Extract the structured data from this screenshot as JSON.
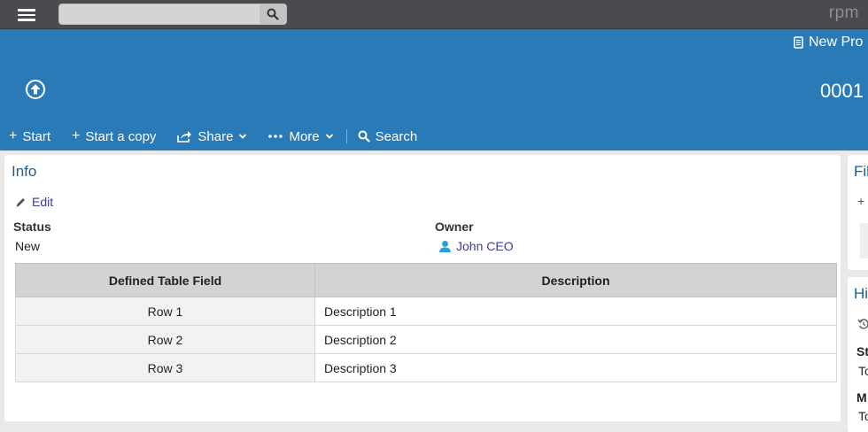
{
  "topbar": {
    "search_placeholder": "",
    "brand": "rpm"
  },
  "header": {
    "process_name": "New Pro",
    "record_number": "0001",
    "actions": {
      "start": "Start",
      "start_copy": "Start a copy",
      "share": "Share",
      "more": "More",
      "search": "Search"
    }
  },
  "info": {
    "title": "Info",
    "edit_label": "Edit",
    "status_label": "Status",
    "status_value": "New",
    "owner_label": "Owner",
    "owner_value": "John CEO",
    "table": {
      "headers": [
        "Defined Table Field",
        "Description"
      ],
      "rows": [
        [
          "Row 1",
          "Description 1"
        ],
        [
          "Row 2",
          "Description 2"
        ],
        [
          "Row 3",
          "Description 3"
        ]
      ]
    }
  },
  "right_panels": {
    "files_title": "Fil",
    "files_add": "+",
    "history_title": "Hi",
    "history_lines": [
      "St",
      "To",
      "M",
      "To"
    ]
  },
  "colors": {
    "header_blue": "#2b7ab8",
    "topbar": "#4a4a4f",
    "link": "#3d3d9a",
    "owner_icon": "#2a9fd8"
  }
}
